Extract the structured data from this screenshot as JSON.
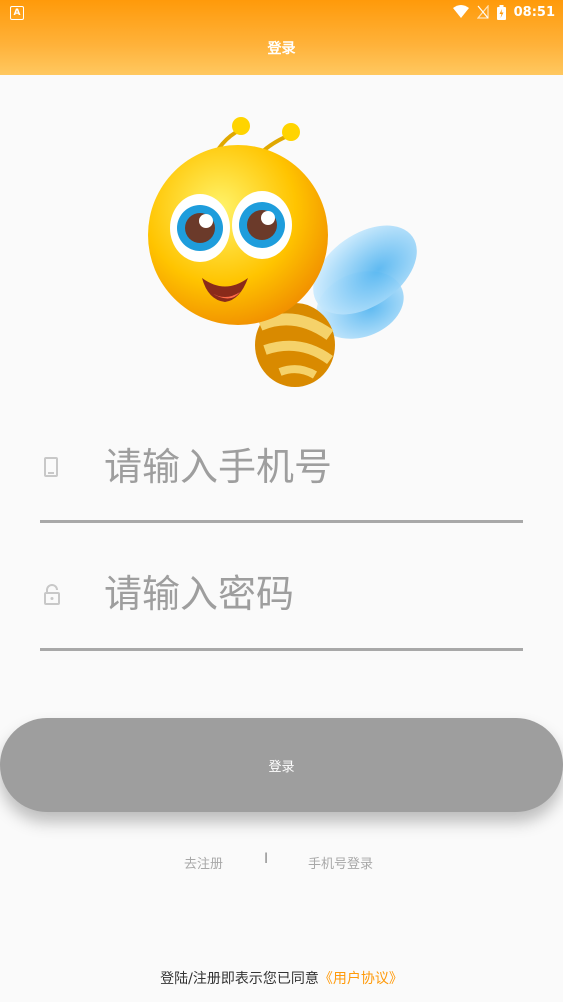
{
  "status_bar": {
    "time": "08:51",
    "notification_icon": "a-notification-icon",
    "icons": [
      "wifi-icon",
      "signal-off-icon",
      "battery-charging-icon"
    ]
  },
  "header": {
    "title": "登录"
  },
  "form": {
    "phone": {
      "placeholder": "请输入手机号",
      "icon": "phone-icon"
    },
    "password": {
      "placeholder": "请输入密码",
      "icon": "lock-icon"
    }
  },
  "login_button": {
    "label": "登录"
  },
  "links": {
    "register": "去注册",
    "separator": "I",
    "phone_login": "手机号登录"
  },
  "footer": {
    "prefix": "登陆/注册即表示您已同意",
    "agreement": "《用户协议》"
  },
  "colors": {
    "accent": "#ff9a0a",
    "button": "#9e9e9e",
    "background": "#fafafa"
  }
}
